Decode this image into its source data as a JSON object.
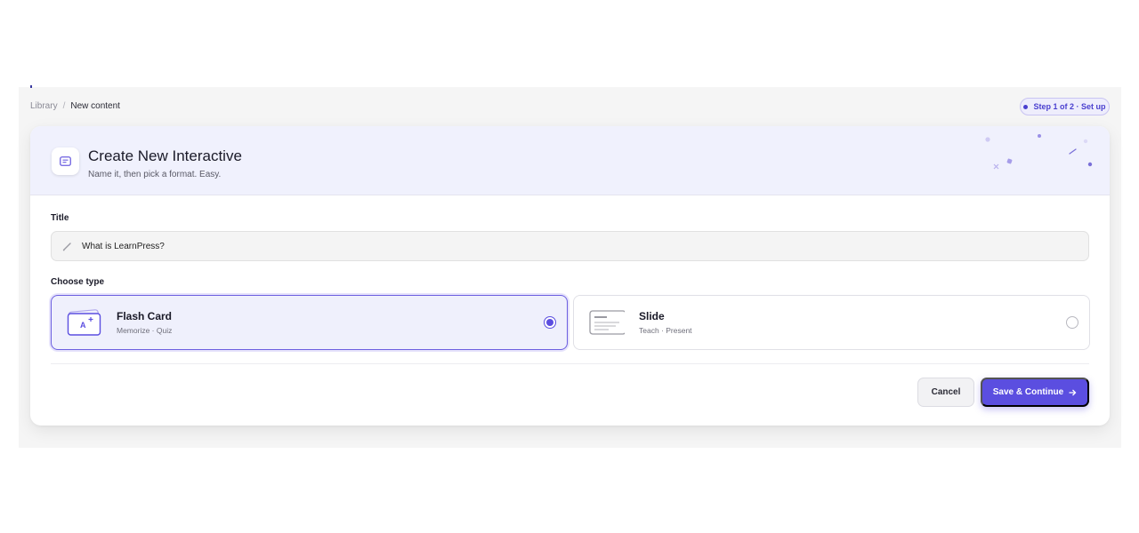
{
  "breadcrumb": {
    "library": "Library",
    "separator": "/",
    "current": "New content"
  },
  "step_badge": "Step 1 of 2 · Set up",
  "header": {
    "title": "Create New Interactive",
    "subtitle": "Name it, then pick a format. Easy.",
    "icon": "card-icon"
  },
  "form": {
    "title_label": "Title",
    "title_value": "What is LearnPress?",
    "type_label": "Choose type",
    "types": [
      {
        "name": "Flash Card",
        "desc": "Memorize · Quiz",
        "icon": "flash-card-icon",
        "selected": true
      },
      {
        "name": "Slide",
        "desc": "Teach · Present",
        "icon": "slide-icon",
        "selected": false
      }
    ]
  },
  "actions": {
    "cancel": "Cancel",
    "save": "Save & Continue"
  },
  "colors": {
    "accent": "#5b4ee0",
    "header_bg": "#f0f1fd"
  }
}
